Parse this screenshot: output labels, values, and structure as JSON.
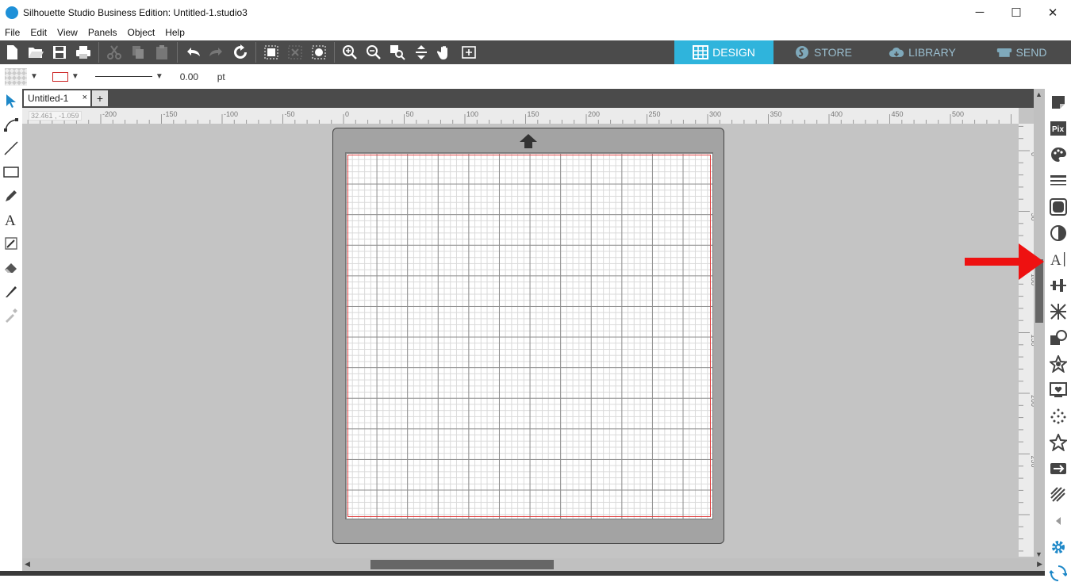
{
  "window": {
    "title": "Silhouette Studio Business Edition: Untitled-1.studio3",
    "minimize": "─",
    "maximize": "☐",
    "close": "✕"
  },
  "menu": [
    "File",
    "Edit",
    "View",
    "Panels",
    "Object",
    "Help"
  ],
  "mode_tabs": [
    {
      "label": "DESIGN",
      "active": true
    },
    {
      "label": "STORE",
      "active": false
    },
    {
      "label": "LIBRARY",
      "active": false
    },
    {
      "label": "SEND",
      "active": false
    }
  ],
  "properties": {
    "line_width": "0.00",
    "unit": "pt"
  },
  "document": {
    "tab_label": "Untitled-1",
    "tab_close": "×",
    "add_tab": "+",
    "cursor_coords": "32.461 , -1.059"
  },
  "ruler": {
    "horizontal_labels": [
      "-200",
      "-150",
      "-100",
      "-50",
      "0",
      "50",
      "100",
      "150",
      "200",
      "250",
      "300",
      "350",
      "400",
      "450",
      "500"
    ],
    "vertical_labels": [
      "0",
      "50",
      "100",
      "150",
      "200",
      "250"
    ]
  },
  "colors": {
    "toolbar_bg": "#4b4b4b",
    "active_tab": "#2fb4dc",
    "workspace_bg": "#c4c4c4",
    "mat_bg": "#a3a3a3",
    "cut_border": "#e04040",
    "annotation_arrow": "#ee1111"
  },
  "annotation": {
    "target": "text-style-panel-icon"
  }
}
